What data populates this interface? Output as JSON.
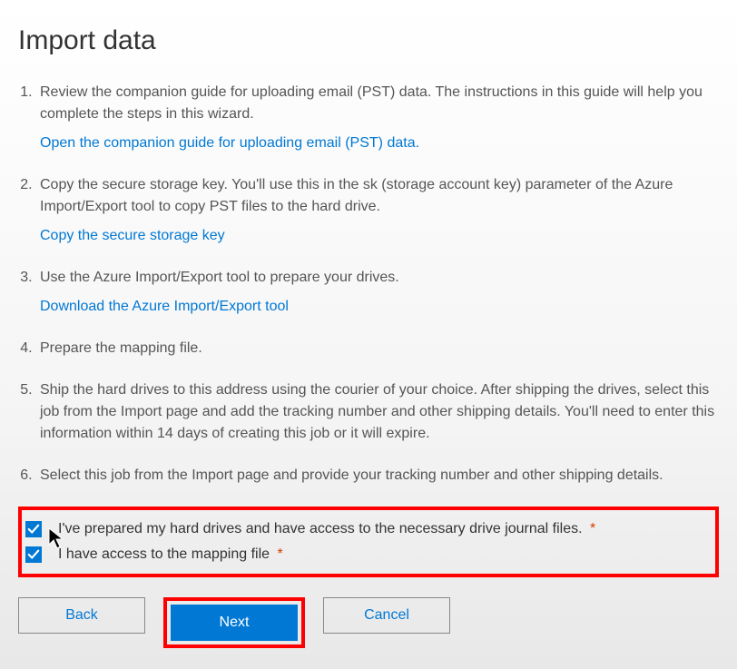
{
  "title": "Import data",
  "steps": [
    {
      "text": "Review the companion guide for uploading email (PST) data. The instructions in this guide will help you complete the steps in this wizard.",
      "link": "Open the companion guide for uploading email (PST) data."
    },
    {
      "text": "Copy the secure storage key. You'll use this in the sk (storage account key) parameter of the Azure Import/Export tool to copy PST files to the hard drive.",
      "link": "Copy the secure storage key"
    },
    {
      "text": "Use the Azure Import/Export tool to prepare your drives.",
      "link": "Download the Azure Import/Export tool"
    },
    {
      "text": "Prepare the mapping file."
    },
    {
      "text": "Ship the hard drives to this address using the courier of your choice. After shipping the drives, select this job from the Import page and add the tracking number and other shipping details. You'll need to enter this information within 14 days of creating this job or it will expire."
    },
    {
      "text": "Select this job from the Import page and provide your tracking number and other shipping details."
    }
  ],
  "checkboxes": {
    "prepared": "I've prepared my hard drives and have access to the necessary drive journal files.",
    "mapping": "I have access to the mapping file"
  },
  "required_marker": "*",
  "buttons": {
    "back": "Back",
    "next": "Next",
    "cancel": "Cancel"
  }
}
